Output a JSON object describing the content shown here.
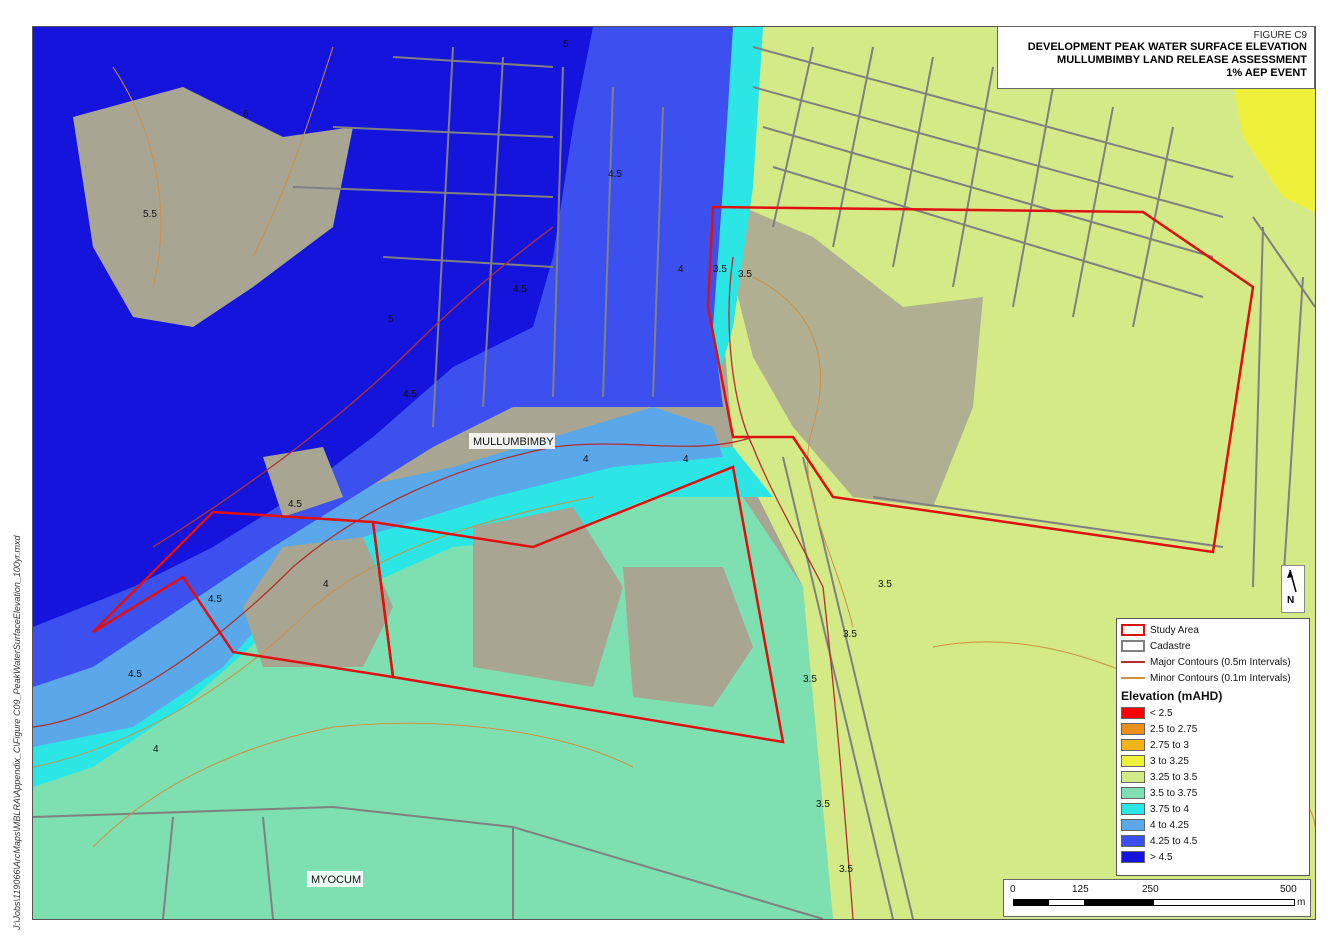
{
  "title": {
    "figure": "FIGURE C9",
    "line1": "DEVELOPMENT PEAK WATER SURFACE ELEVATION",
    "line2": "MULLUMBIMBY LAND RELEASE ASSESSMENT",
    "line3": "1% AEP EVENT"
  },
  "places": {
    "mullumbimby": "MULLUMBIMBY",
    "myocum": "MYOCUM"
  },
  "contour_labels": [
    "5",
    "4.5",
    "4",
    "3.5",
    "6",
    "5.5"
  ],
  "north": "N",
  "legend": {
    "study_area": "Study Area",
    "cadastre": "Cadastre",
    "major_contours": "Major Contours (0.5m Intervals)",
    "minor_contours": "Minor Contours (0.1m Intervals)",
    "elevation_heading": "Elevation (mAHD)",
    "classes": [
      {
        "label": "< 2.5",
        "color": "#ff0000"
      },
      {
        "label": "2.5 to 2.75",
        "color": "#e8901a"
      },
      {
        "label": "2.75 to 3",
        "color": "#f0b418"
      },
      {
        "label": "3 to 3.25",
        "color": "#eef03a"
      },
      {
        "label": "3.25 to 3.5",
        "color": "#d3ea86"
      },
      {
        "label": "3.5 to 3.75",
        "color": "#7ee0b0"
      },
      {
        "label": "3.75 to 4",
        "color": "#2ce6e6"
      },
      {
        "label": "4 to 4.25",
        "color": "#5aa8ea"
      },
      {
        "label": "4.25 to 4.5",
        "color": "#3c50f0"
      },
      {
        "label": "> 4.5",
        "color": "#1414dc"
      }
    ],
    "study_area_color": "#e01010",
    "cadastre_color": "#808080",
    "major_contour_color": "#b03030",
    "minor_contour_color": "#d09040"
  },
  "scale": {
    "labels": [
      "0",
      "125",
      "250",
      "500"
    ],
    "unit": "m"
  },
  "file_path": "J:\\Jobs\\119066\\ArcMaps\\MBLRA\\Appendix_C\\Figure C09_PeakWaterSurfaceElevation_100yr.mxd"
}
